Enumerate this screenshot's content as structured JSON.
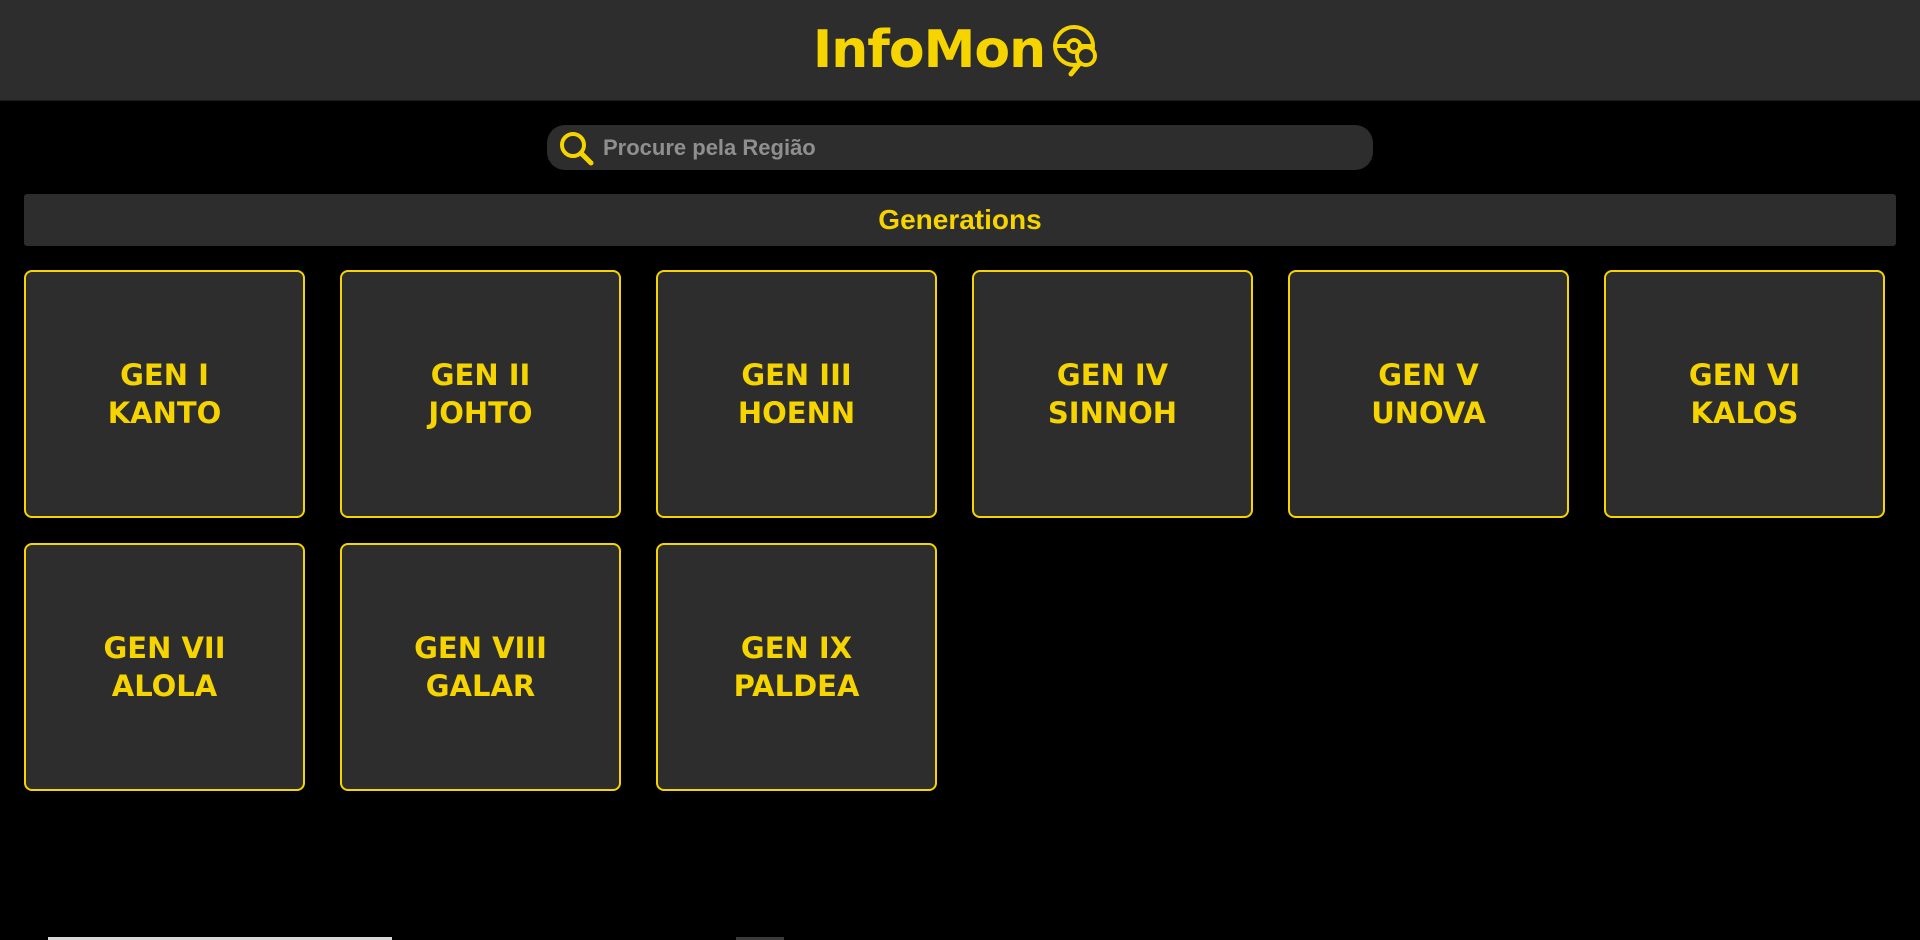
{
  "header": {
    "logo_text": "InfoMon",
    "logo_icon": "pokeball-search-icon"
  },
  "search": {
    "placeholder": "Procure pela Região",
    "value": "",
    "icon": "search-icon"
  },
  "section": {
    "title": "Generations"
  },
  "generations": [
    {
      "gen": "GEN I",
      "region": "KANTO"
    },
    {
      "gen": "GEN II",
      "region": "JOHTO"
    },
    {
      "gen": "GEN III",
      "region": "HOENN"
    },
    {
      "gen": "GEN IV",
      "region": "SINNOH"
    },
    {
      "gen": "GEN V",
      "region": "UNOVA"
    },
    {
      "gen": "GEN VI",
      "region": "KALOS"
    },
    {
      "gen": "GEN VII",
      "region": "ALOLA"
    },
    {
      "gen": "GEN VIII",
      "region": "GALAR"
    },
    {
      "gen": "GEN IX",
      "region": "PALDEA"
    }
  ],
  "colors": {
    "accent": "#f5d400",
    "panel": "#2d2d2d",
    "background": "#000000",
    "placeholder": "#8f8f8f"
  }
}
